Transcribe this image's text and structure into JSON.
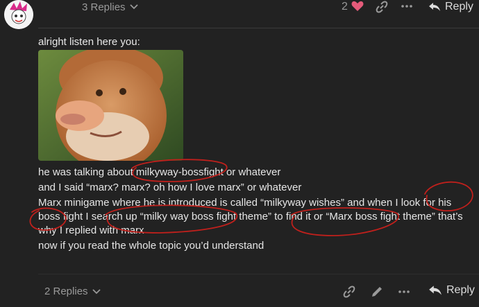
{
  "post_header": {
    "replies_label": "3 Replies",
    "like_count": "2",
    "reply_label": "Reply"
  },
  "post": {
    "intro": "alright listen here you:",
    "lines": [
      "he was talking about milkyway-bossfight or whatever",
      "and I said “marx? marx? oh how I love marx” or whatever",
      "Marx minigame where he is introduced is called “milkyway wishes” and when I look for his boss fight I search up “milky way boss fight theme” to find it or “Marx boss fight theme” that’s why I replied with marx",
      "now if you read the whole topic you’d understand"
    ]
  },
  "post_footer": {
    "replies_label": "2 Replies",
    "reply_label": "Reply"
  },
  "colors": {
    "background": "#222222",
    "heart": "#e45b7a",
    "annotation_red": "#c0201c"
  },
  "icons": {
    "replies_chevron": "chevron-down-icon",
    "heart": "heart-icon",
    "link": "link-icon",
    "more": "ellipsis-icon",
    "reply": "reply-arrow-icon",
    "edit": "pencil-icon"
  }
}
